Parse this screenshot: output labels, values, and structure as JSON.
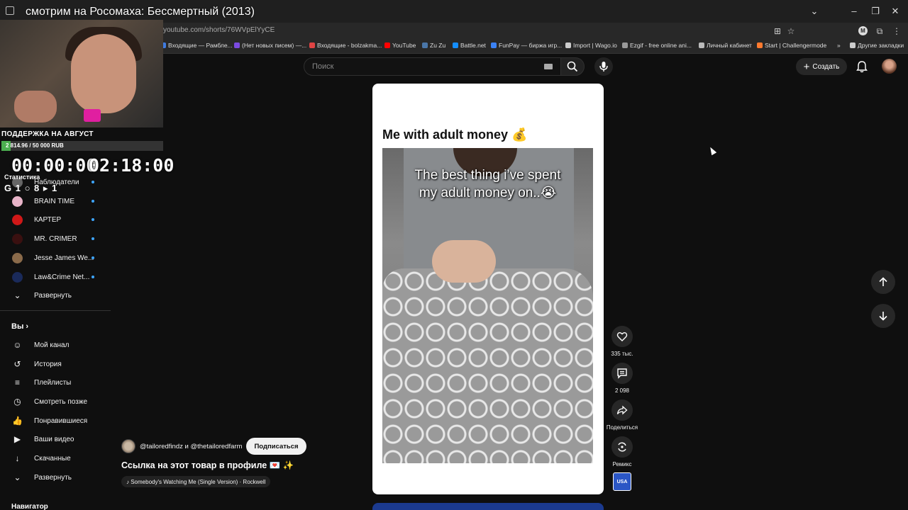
{
  "stream": {
    "title": "смотрим на Росомаха: Бессмертный (2013)",
    "support_title": "ПОДДЕРЖКА НА АВГУСТ",
    "support_progress": "2 814.96 / 50 000 RUB",
    "support_fraction": 0.056,
    "timer_left": "00:00:00",
    "timer_right": "02:18:00",
    "stats_label": "Статистика",
    "stats_values": "G 1  ○ 8  ▸ 1"
  },
  "browser": {
    "url": "youtube.com/shorts/76WVpElYyCE",
    "bookmarks": [
      {
        "label": "Входящие — Рамбле...",
        "color": "#3f7be0"
      },
      {
        "label": "(Нет новых писем) —...",
        "color": "#7b4ae0"
      },
      {
        "label": "Входящие - bolzakma...",
        "color": "#e04444"
      },
      {
        "label": "YouTube",
        "color": "#ff0000"
      },
      {
        "label": "Zu Zu",
        "color": "#4a76a8"
      },
      {
        "label": "Battle.net",
        "color": "#148eff"
      },
      {
        "label": "FunPay — биржа игр...",
        "color": "#3b82f6"
      },
      {
        "label": "Import | Wago.io",
        "color": "#cccccc"
      },
      {
        "label": "Ezgif - free online ani...",
        "color": "#999999"
      },
      {
        "label": "Личный кабинет",
        "color": "#bbbbbb"
      },
      {
        "label": "Start | Challengermode",
        "color": "#ff7a2f"
      }
    ],
    "other_bookmarks": "Другие закладки",
    "profile_letter": "M"
  },
  "sidebar": {
    "subscriptions": [
      {
        "label": "Наблюдатели",
        "avatar_color": "#666666"
      },
      {
        "label": "BRAIN TIME",
        "avatar_color": "#e8b4c8"
      },
      {
        "label": "КАРТЕР",
        "avatar_color": "#d01818"
      },
      {
        "label": "MR. CRIMER",
        "avatar_color": "#3a1010"
      },
      {
        "label": "Jesse James We...",
        "avatar_color": "#8a6a4a"
      },
      {
        "label": "Law&Crime Net...",
        "avatar_color": "#1a2a5a"
      }
    ],
    "expand_label": "Развернуть",
    "you_heading": "Вы",
    "you_items": [
      {
        "label": "Мой канал",
        "icon": "user-icon"
      },
      {
        "label": "История",
        "icon": "history-icon"
      },
      {
        "label": "Плейлисты",
        "icon": "playlists-icon"
      },
      {
        "label": "Смотреть позже",
        "icon": "clock-icon"
      },
      {
        "label": "Понравившиеся",
        "icon": "thumbs-up-icon"
      },
      {
        "label": "Ваши видео",
        "icon": "video-icon"
      },
      {
        "label": "Скачанные",
        "icon": "download-icon"
      }
    ],
    "expand_label_2": "Развернуть",
    "navigator_heading": "Навигатор"
  },
  "header": {
    "search_placeholder": "Поиск",
    "create_label": "Создать"
  },
  "short": {
    "caption": "Me with adult money 💰",
    "video_text_line1": "The best thing i’ve spent",
    "video_text_line2": "my adult money on..😭",
    "likes": "335 тыс.",
    "comments": "2 098",
    "share_label": "Поделиться",
    "remix_label": "Ремикс",
    "remix_thumb_text": "USA",
    "channels": "@tailoredfindz и @thetailoredfarm",
    "subscribe_label": "Подписаться",
    "title": "Ссылка на этот товар в профиле 💌 ✨",
    "music": "♪ Somebody's Watching Me (Single Version) · Rockwell"
  },
  "colors": {
    "background": "#0f0f0f",
    "accent_blue": "#3ea6ff",
    "support_green": "#4caf50"
  }
}
